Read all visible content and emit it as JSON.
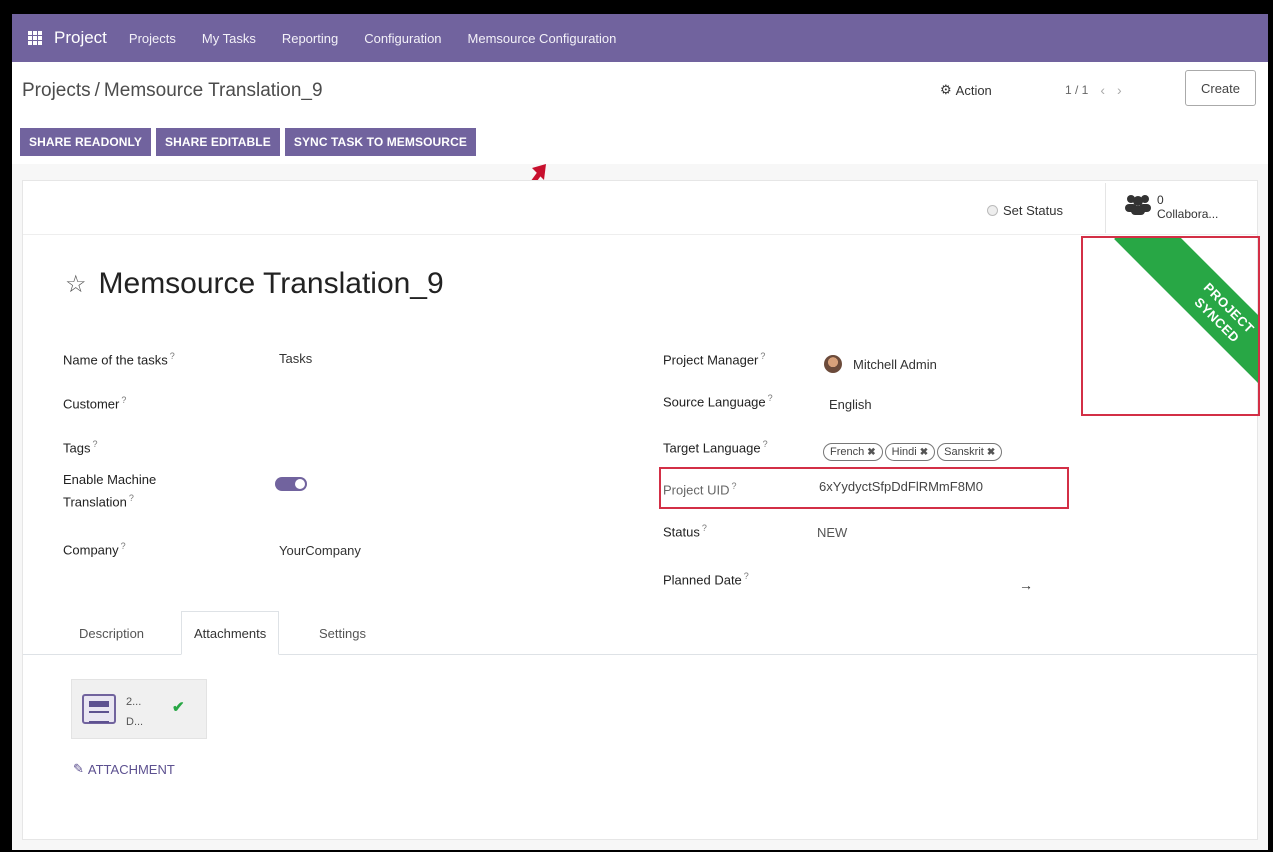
{
  "app": {
    "title": "Project"
  },
  "nav": {
    "items": [
      "Projects",
      "My Tasks",
      "Reporting",
      "Configuration",
      "Memsource Configuration"
    ]
  },
  "breadcrumb": {
    "parent": "Projects",
    "separator": "/",
    "current": "Memsource Translation_9"
  },
  "control": {
    "action_label": "Action",
    "pager": "1 / 1",
    "create_label": "Create"
  },
  "header_buttons": [
    "SHARE READONLY",
    "SHARE EDITABLE",
    "SYNC TASK TO MEMSOURCE"
  ],
  "status": {
    "set_status_label": "Set Status",
    "collaborators_count": "0",
    "collaborators_label": "Collabora..."
  },
  "ribbon": {
    "line1": "PROJECT",
    "line2": "SYNCED",
    "color": "#28a745"
  },
  "record": {
    "title": "Memsource Translation_9",
    "left_fields": {
      "name_of_tasks": {
        "label": "Name of the tasks",
        "value": "Tasks"
      },
      "customer": {
        "label": "Customer",
        "value": ""
      },
      "tags": {
        "label": "Tags",
        "value": ""
      },
      "machine_translation": {
        "label_line1": "Enable Machine",
        "label_line2": "Translation",
        "enabled": true
      },
      "company": {
        "label": "Company",
        "value": "YourCompany"
      }
    },
    "right_fields": {
      "project_manager": {
        "label": "Project Manager",
        "value": "Mitchell Admin"
      },
      "source_language": {
        "label": "Source Language",
        "value": "English"
      },
      "target_language": {
        "label": "Target Language",
        "tags": [
          "French",
          "Hindi",
          "Sanskrit"
        ]
      },
      "project_uid": {
        "label": "Project UID",
        "value": "6xYydyctSfpDdFlRMmF8M0"
      },
      "status": {
        "label": "Status",
        "value": "NEW"
      },
      "planned_date": {
        "label": "Planned Date",
        "value": "→"
      }
    }
  },
  "tabs": [
    "Description",
    "Attachments",
    "Settings"
  ],
  "attachment": {
    "name_line1": "2...",
    "name_line2": "D...",
    "link_label": "ATTACHMENT"
  },
  "colors": {
    "brand": "#71639e",
    "highlight": "#d32f46",
    "success": "#28a745"
  }
}
